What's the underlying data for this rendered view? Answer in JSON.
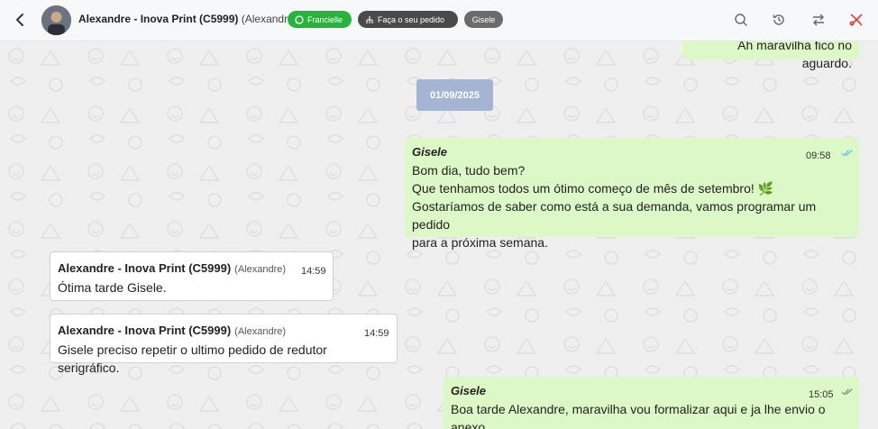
{
  "header": {
    "contact_name": "Alexandre - Inova Print (C5999)",
    "contact_alias": "(Alexandre)",
    "tags": {
      "agent": "Francielle",
      "order": "Faça o seu pedido",
      "user": "Gisele"
    },
    "icons": [
      "back-icon",
      "search-icon",
      "history-icon",
      "transfer-icon",
      "close-ticket-icon"
    ]
  },
  "colors": {
    "outgoing_bubble": "#dcf8c6",
    "incoming_bubble": "#ffffff",
    "tag_green": "#27b33c",
    "date_chip": "#a5b4d2",
    "close_icon": "#e23b3b",
    "read_check": "#4fc3f7"
  },
  "chat": {
    "prev_message_tail": "Ah maravilha fico no aguardo.",
    "date_separator": "01/09/2025",
    "messages": [
      {
        "sender": "Gisele",
        "time": "09:58",
        "lines": [
          "Bom dia, tudo bem?",
          "Que tenhamos todos um ótimo começo de mês de setembro! 🌿",
          "Gostaríamos de saber como está a sua demanda, vamos programar um pedido",
          "para a próxima semana."
        ]
      },
      {
        "sender": "Alexandre - Inova Print (C5999)",
        "alias": "(Alexandre)",
        "time": "14:59",
        "text": "Ótima tarde Gisele."
      },
      {
        "sender": "Alexandre - Inova Print (C5999)",
        "alias": "(Alexandre)",
        "time": "14:59",
        "text": "Gisele preciso repetir o ultimo pedido de redutor serigráfico."
      },
      {
        "sender": "Gisele",
        "time": "15:05",
        "text": "Boa tarde Alexandre, maravilha vou formalizar aqui e ja lhe envio o anexo"
      }
    ]
  }
}
